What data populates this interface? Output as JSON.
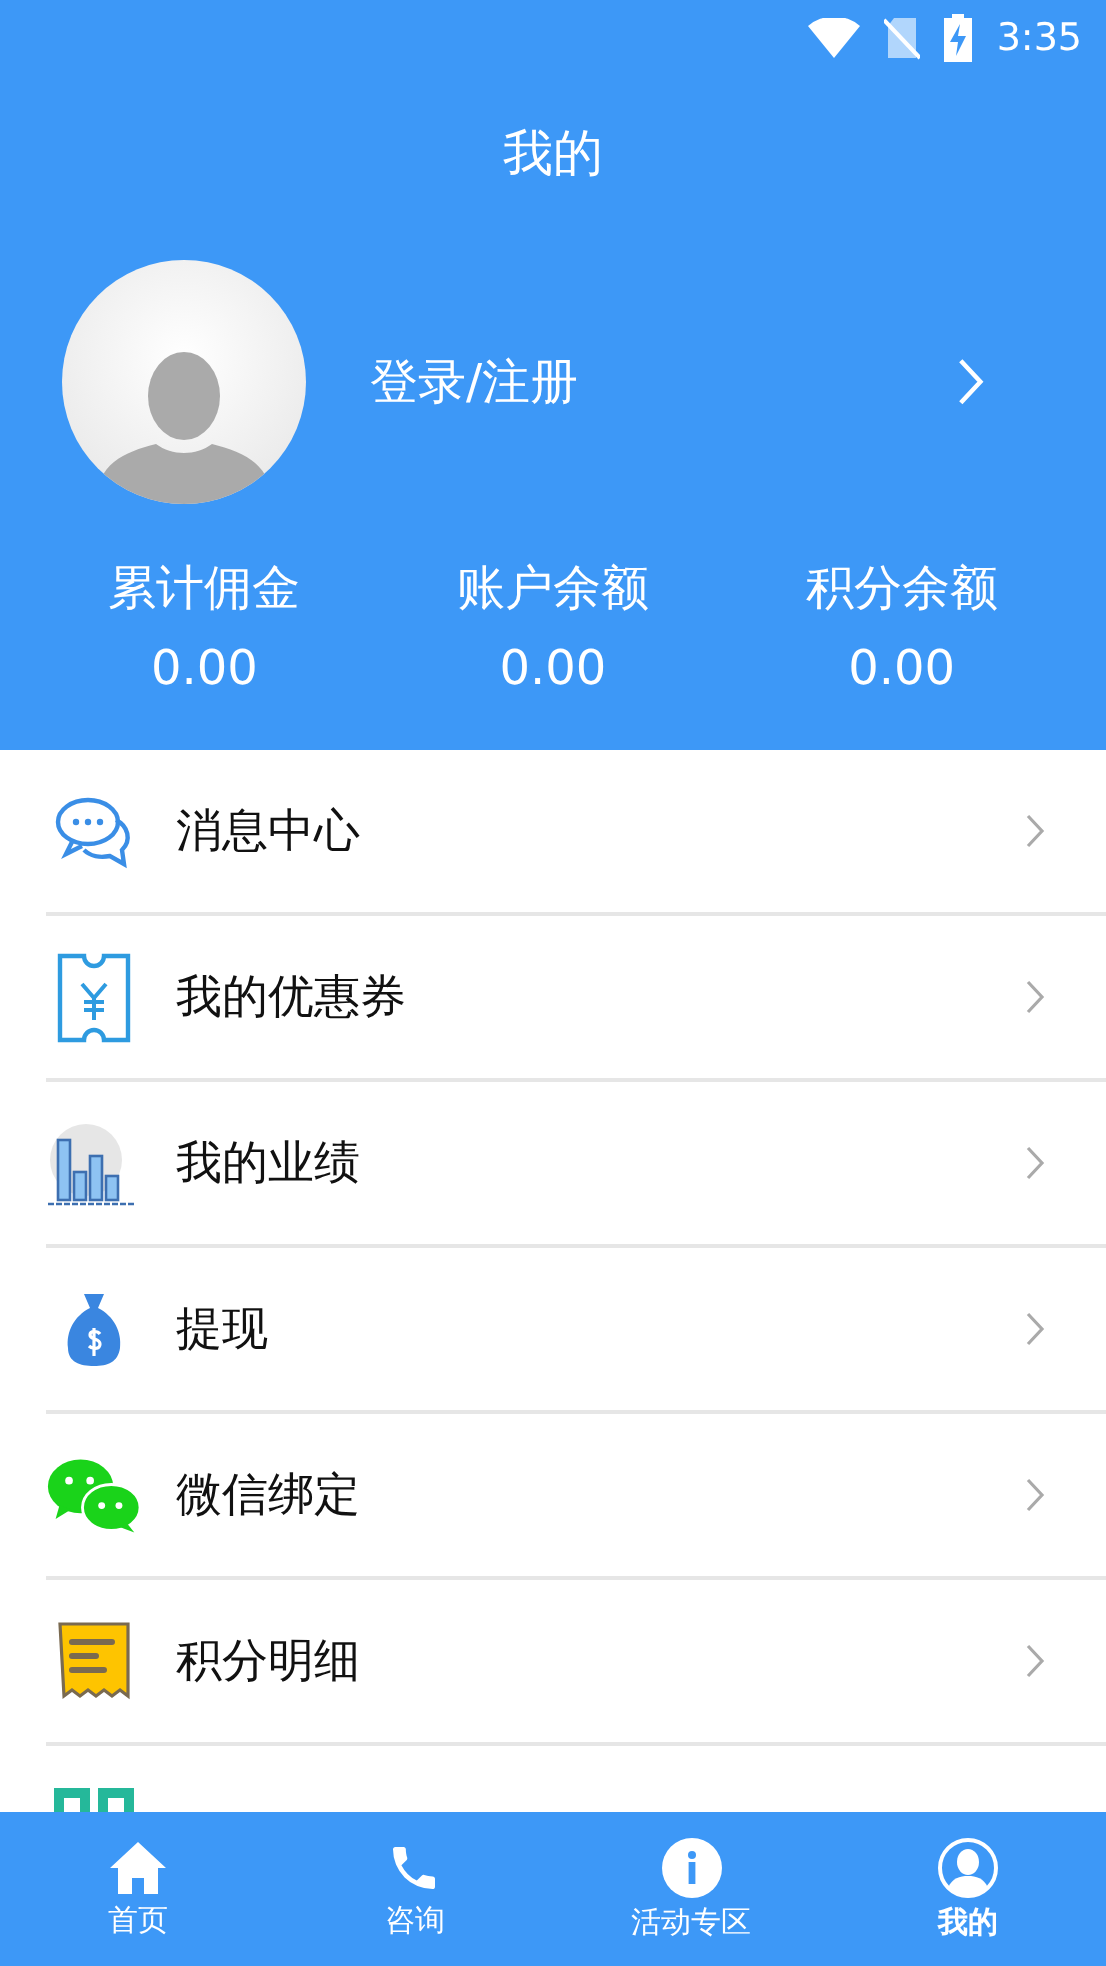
{
  "status_bar": {
    "time": "3:35"
  },
  "header": {
    "title": "我的",
    "login": "登录/注册"
  },
  "stats": [
    {
      "label": "累计佣金",
      "value": "0.00"
    },
    {
      "label": "账户余额",
      "value": "0.00"
    },
    {
      "label": "积分余额",
      "value": "0.00"
    }
  ],
  "menu": [
    {
      "kind": "message",
      "label": "消息中心"
    },
    {
      "kind": "coupon",
      "label": "我的优惠券"
    },
    {
      "kind": "chart",
      "label": "我的业绩"
    },
    {
      "kind": "moneybag",
      "label": "提现"
    },
    {
      "kind": "wechat",
      "label": "微信绑定"
    },
    {
      "kind": "receipt",
      "label": "积分明细"
    },
    {
      "kind": "qrcode"
    }
  ],
  "tabs": [
    {
      "kind": "home",
      "label": "首页",
      "selected": false
    },
    {
      "kind": "phone",
      "label": "咨询",
      "selected": false
    },
    {
      "kind": "info",
      "label": "活动专区",
      "selected": false
    },
    {
      "kind": "user",
      "label": "我的",
      "selected": true
    }
  ]
}
